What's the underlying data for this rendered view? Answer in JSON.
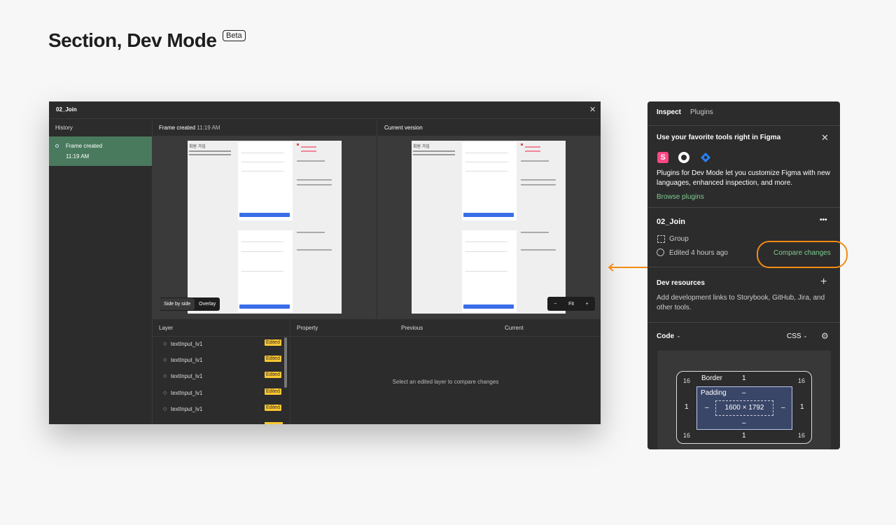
{
  "heading": {
    "title": "Section,  Dev Mode",
    "badge": "Beta"
  },
  "window": {
    "title": "02_Join",
    "history": {
      "header": "History",
      "item_label": "Frame created",
      "item_time": "11:19 AM"
    },
    "left_column": {
      "label": "Frame created",
      "time": "11:19 AM"
    },
    "right_column": {
      "label": "Current version"
    },
    "mini_page": {
      "heading": "회원 가입"
    },
    "view_toggle": {
      "side_by_side": "Side by side",
      "overlay": "Overlay"
    },
    "zoom": {
      "minus": "−",
      "fit": "Fit",
      "plus": "+"
    },
    "layers": {
      "header": "Layer",
      "rows": [
        "textInput_lv1",
        "textInput_lv1",
        "textInput_lv1",
        "textInput_lv1",
        "textInput_lv1"
      ],
      "badge": "Edited"
    },
    "compare_table": {
      "headers": [
        "Property",
        "Previous",
        "Current"
      ],
      "empty_message": "Select an edited layer to compare changes"
    }
  },
  "panel": {
    "tabs": [
      "Inspect",
      "Plugins"
    ],
    "promo": {
      "title": "Use your favorite tools right in Figma",
      "body": "Plugins for Dev Mode let you customize Figma with new languages, enhanced inspection, and more.",
      "link": "Browse plugins",
      "plugin_icons": [
        "storybook-icon",
        "github-icon",
        "jira-icon"
      ]
    },
    "selection": {
      "name": "02_Join",
      "more": "•••",
      "type": "Group",
      "edited": "Edited 4 hours ago",
      "compare": "Compare changes"
    },
    "dev_resources": {
      "title": "Dev resources",
      "body": "Add development links to Storybook, GitHub, Jira, and other tools."
    },
    "code": {
      "label": "Code",
      "language": "CSS",
      "box": {
        "border_label": "Border",
        "border_value": "1",
        "padding_label": "Padding",
        "padding_top": "–",
        "padding_left": "–",
        "padding_right": "–",
        "padding_bottom": "–",
        "size": "1600 × 1792",
        "left": "1",
        "right": "1",
        "bottom": "1",
        "corner_tl": "16",
        "corner_tr": "16",
        "corner_bl": "16",
        "corner_br": "16"
      }
    }
  },
  "colors": {
    "accent_orange": "#f28c14",
    "history_green": "#4a7a5e",
    "edited_badge": "#ffc832",
    "link_green": "#7ecb8f"
  }
}
